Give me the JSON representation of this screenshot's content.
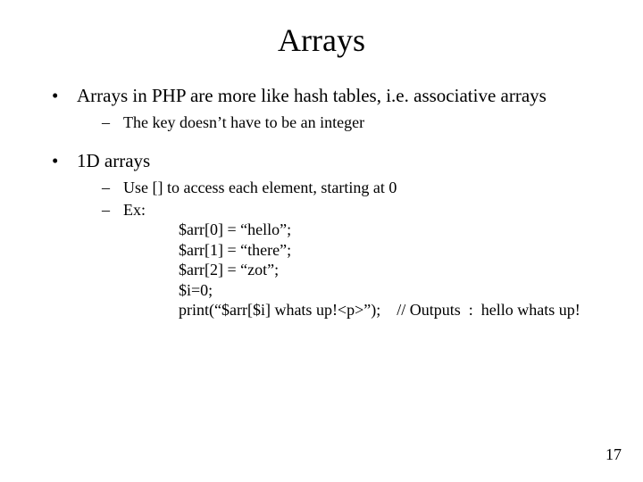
{
  "title": "Arrays",
  "bullets": [
    {
      "text": "Arrays in PHP are more like hash tables, i.e. associative arrays",
      "sub": [
        {
          "text": "The key doesn’t have to be an integer"
        }
      ]
    },
    {
      "text": "1D arrays",
      "sub": [
        {
          "text": "Use [] to access each element, starting at 0"
        },
        {
          "text": "Ex:"
        }
      ]
    }
  ],
  "code": [
    "$arr[0] = “hello”;",
    "$arr[1] = “there”;",
    "$arr[2] = “zot”;",
    "$i=0;",
    "print(“$arr[$i] whats up!<p>”);    // Outputs  :  hello whats up!"
  ],
  "page_number": "17"
}
